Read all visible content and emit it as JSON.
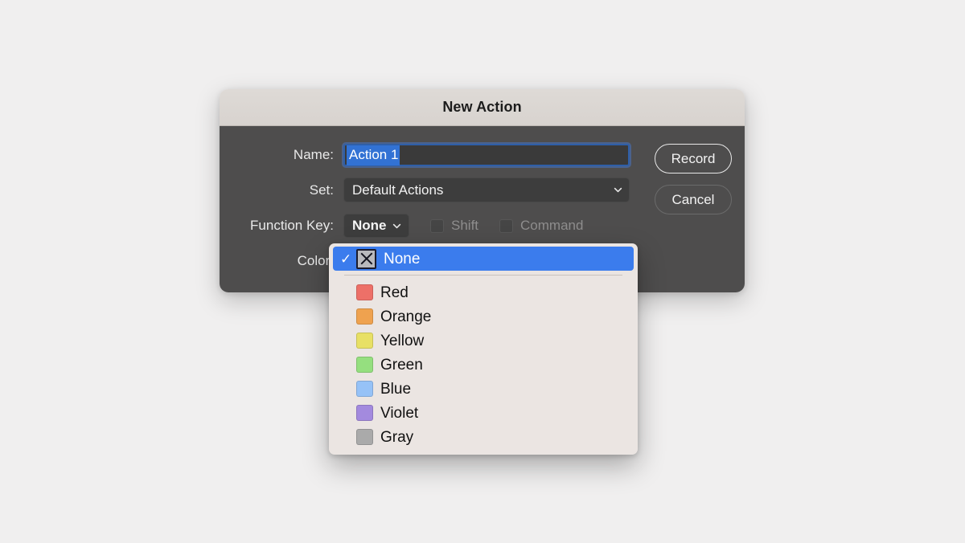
{
  "dialog": {
    "title": "New Action",
    "rows": {
      "name": {
        "label": "Name:",
        "value": "Action 1"
      },
      "set": {
        "label": "Set:",
        "value": "Default Actions"
      },
      "function_key": {
        "label": "Function Key:",
        "value": "None",
        "modifiers": [
          {
            "label": "Shift",
            "checked": false,
            "enabled": false
          },
          {
            "label": "Command",
            "checked": false,
            "enabled": false
          }
        ]
      },
      "color": {
        "label": "Color:"
      }
    },
    "buttons": {
      "record": "Record",
      "cancel": "Cancel"
    }
  },
  "color_menu": {
    "selected": "None",
    "items": [
      {
        "label": "None",
        "swatch": null,
        "icon": "none-x-icon",
        "selected": true
      },
      {
        "label": "Red",
        "swatch": "#ed7068",
        "icon": "color-swatch",
        "selected": false
      },
      {
        "label": "Orange",
        "swatch": "#efa24f",
        "icon": "color-swatch",
        "selected": false
      },
      {
        "label": "Yellow",
        "swatch": "#e8e065",
        "icon": "color-swatch",
        "selected": false
      },
      {
        "label": "Green",
        "swatch": "#95df7f",
        "icon": "color-swatch",
        "selected": false
      },
      {
        "label": "Blue",
        "swatch": "#96c2f7",
        "icon": "color-swatch",
        "selected": false
      },
      {
        "label": "Violet",
        "swatch": "#a38ade",
        "icon": "color-swatch",
        "selected": false
      },
      {
        "label": "Gray",
        "swatch": "#aaaaaa",
        "icon": "color-swatch",
        "selected": false
      }
    ],
    "check_glyph": "✓"
  },
  "colors": {
    "page_background": "#f0efef",
    "dialog_body": "#4e4d4d",
    "titlebar": "#dedad6",
    "menu_background": "#ebe5e2",
    "selection_blue": "#3b7ced",
    "field_selection_blue": "#3272d4"
  }
}
